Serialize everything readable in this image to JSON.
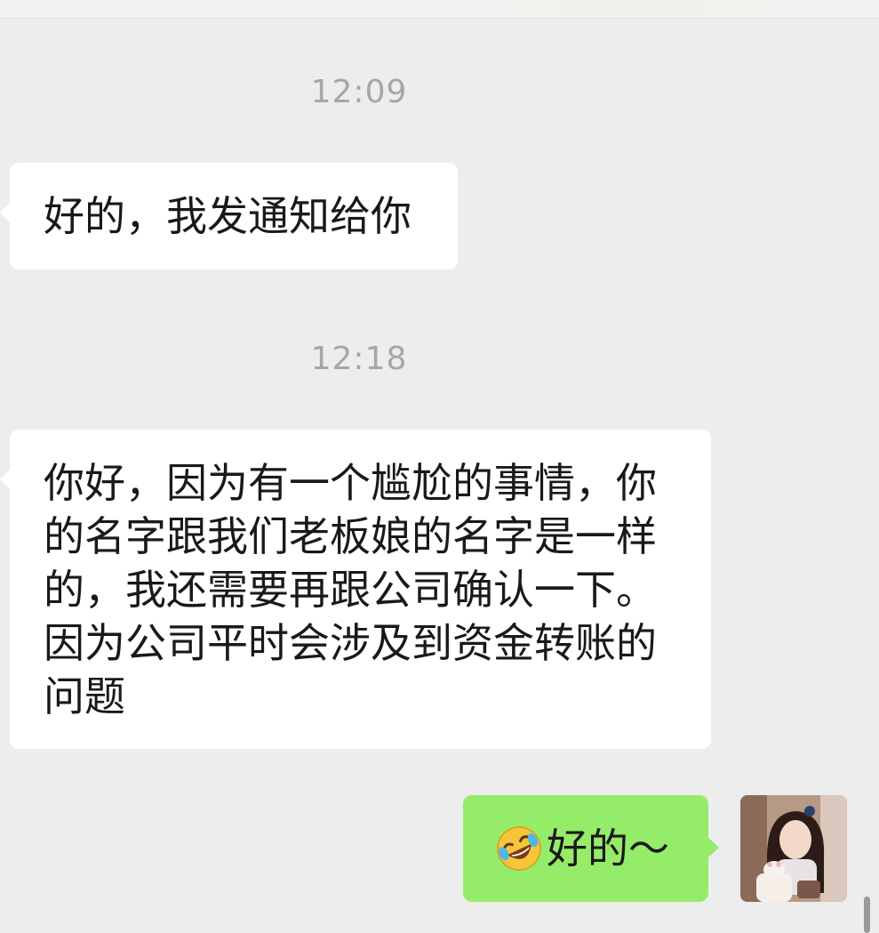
{
  "chat": {
    "timestamps": [
      "12:09",
      "12:18"
    ],
    "messages": [
      {
        "sender": "contact",
        "text": "好的，我发通知给你"
      },
      {
        "sender": "contact",
        "text": "你好，因为有一个尴尬的事情，你\n的名字跟我们老板娘的名字是一样\n的，我还需要再跟公司确认一下。\n因为公司平时会涉及到资金转账的\n问题"
      },
      {
        "sender": "me",
        "emoji": "rolling-on-floor-laughing-emoji",
        "text": "好的～"
      }
    ]
  },
  "colors": {
    "background": "#ededed",
    "incoming_bubble": "#ffffff",
    "outgoing_bubble": "#95ec69",
    "timestamp_text": "#a6a6a6"
  },
  "icons": {
    "avatar": "user-avatar-photo",
    "emoji": "rolling-on-floor-laughing-emoji"
  }
}
